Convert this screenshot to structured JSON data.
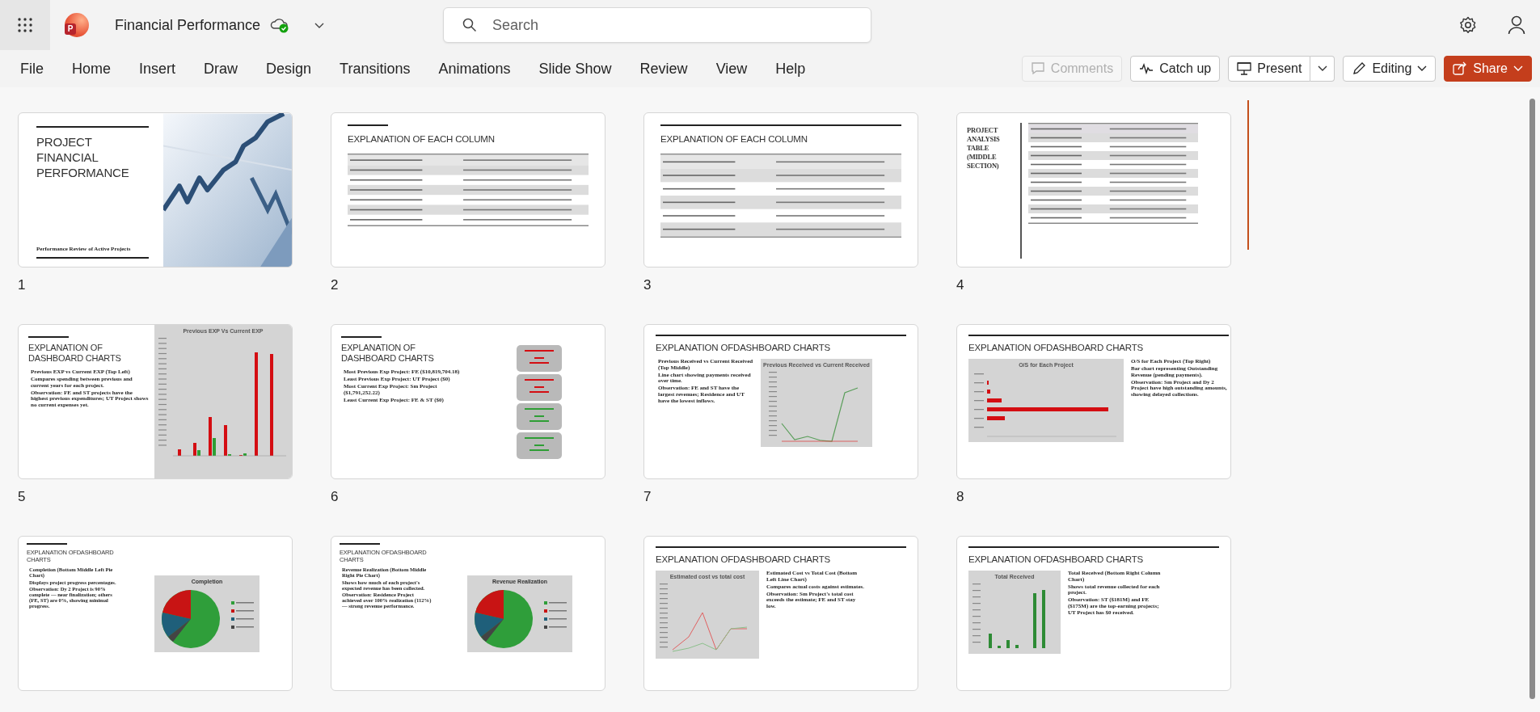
{
  "app": {
    "logo_letter": "P",
    "title": "Financial Performance",
    "search": {
      "placeholder": "Search"
    }
  },
  "menu": [
    {
      "label": "File"
    },
    {
      "label": "Home"
    },
    {
      "label": "Insert"
    },
    {
      "label": "Draw"
    },
    {
      "label": "Design"
    },
    {
      "label": "Transitions"
    },
    {
      "label": "Animations"
    },
    {
      "label": "Slide Show"
    },
    {
      "label": "Review"
    },
    {
      "label": "View"
    },
    {
      "label": "Help"
    }
  ],
  "actions": [
    {
      "kind": "comments",
      "label": "Comments",
      "disabled": true
    },
    {
      "kind": "catchup",
      "label": "Catch up",
      "disabled": false
    },
    {
      "kind": "present",
      "label": "Present",
      "disabled": false
    },
    {
      "kind": "editing",
      "label": "Editing",
      "disabled": false
    },
    {
      "kind": "share",
      "label": "Share",
      "disabled": false
    }
  ],
  "slides": [
    {
      "number": "1",
      "kind": "cover",
      "title": "PROJECT FINANCIAL PERFORMANCE",
      "subtitle": "Performance Review of Active Projects"
    },
    {
      "number": "2",
      "kind": "table",
      "title": "EXPLANATION OF EACH COLUMN"
    },
    {
      "number": "3",
      "kind": "table",
      "title": "EXPLANATION OF EACH COLUMN"
    },
    {
      "number": "4",
      "kind": "side-table",
      "title": "PROJECT ANALYSIS TABLE (MIDDLE SECTION)"
    },
    {
      "number": "5",
      "kind": "bars",
      "title": "EXPLANATION OF DASHBOARD CHARTS",
      "chart_title": "Previous EXP Vs Current EXP",
      "bullets": [
        "Previous EXP vs Current EXP (Top Left)",
        "Compares spending between previous and current years for each project.",
        "Observation: FE and ST projects have the highest previous expenditures; UT Project shows no current expenses yet."
      ]
    },
    {
      "number": "6",
      "kind": "cards",
      "title": "EXPLANATION OF DASHBOARD CHARTS",
      "bullets": [
        "Most Previous Exp Project: FE ($10,819,704.18)",
        "Least Previous Exp Project: UT Project ($0)",
        "Most Current Exp Project: Sm Project ($1,791,252.22)",
        "Least Current Exp Project: FE & ST ($0)"
      ]
    },
    {
      "number": "7",
      "kind": "line",
      "title": "EXPLANATION OFDASHBOARD CHARTS",
      "chart_title": "Previous Received vs Current Received",
      "bullets": [
        "Previous Received vs Current Received (Top Middle)",
        "Line chart showing payments received over time.",
        "Observation: FE and ST have the largest revenues; Residence and UT have the lowest inflows."
      ]
    },
    {
      "number": "8",
      "kind": "hbars",
      "title": "EXPLANATION OFDASHBOARD CHARTS",
      "chart_title": "O/S for Each Project",
      "bullets": [
        "O/S for Each Project (Top Right)",
        "Bar chart representing Outstanding Revenue (pending payments).",
        "Observation: Sm Project and Dy 2 Project have high outstanding amounts, showing delayed collections."
      ]
    },
    {
      "kind": "pie",
      "title": "EXPLANATION OFDASHBOARD CHARTS",
      "chart_title": "Completion",
      "bullets": [
        "Completion (Bottom Middle Left Pie Chart)",
        "Displays project progress percentages.",
        "Observation: Dy 2 Project is 90% complete — near finalization; others (FE, ST) are 0%, showing minimal progress."
      ]
    },
    {
      "kind": "pie",
      "title": "EXPLANATION OFDASHBOARD CHARTS",
      "chart_title": "Revenue Realization",
      "bullets": [
        "Revenue Realization (Bottom Middle Right Pie Chart)",
        "Shows how much of each project's expected revenue has been collected.",
        "Observation: Residence Project achieved over 100% realization (112%) — strong revenue performance."
      ]
    },
    {
      "kind": "cost-line",
      "title": "EXPLANATION OFDASHBOARD CHARTS",
      "chart_title": "Estimated cost vs total cost",
      "bullets": [
        "Estimated Cost vs Total Cost (Bottom Left Line Chart)",
        "Compares actual costs against estimates.",
        "Observation: Sm Project's total cost exceeds the estimate; FE and ST stay low."
      ]
    },
    {
      "kind": "columns",
      "title": "EXPLANATION OFDASHBOARD CHARTS",
      "chart_title": "Total Received",
      "bullets": [
        "Total Received (Bottom Right Column Chart)",
        "Shows total revenue collected for each project.",
        "Observation: ST ($181M) and FE ($175M) are the top-earning projects; UT Project has $0 received."
      ]
    }
  ]
}
